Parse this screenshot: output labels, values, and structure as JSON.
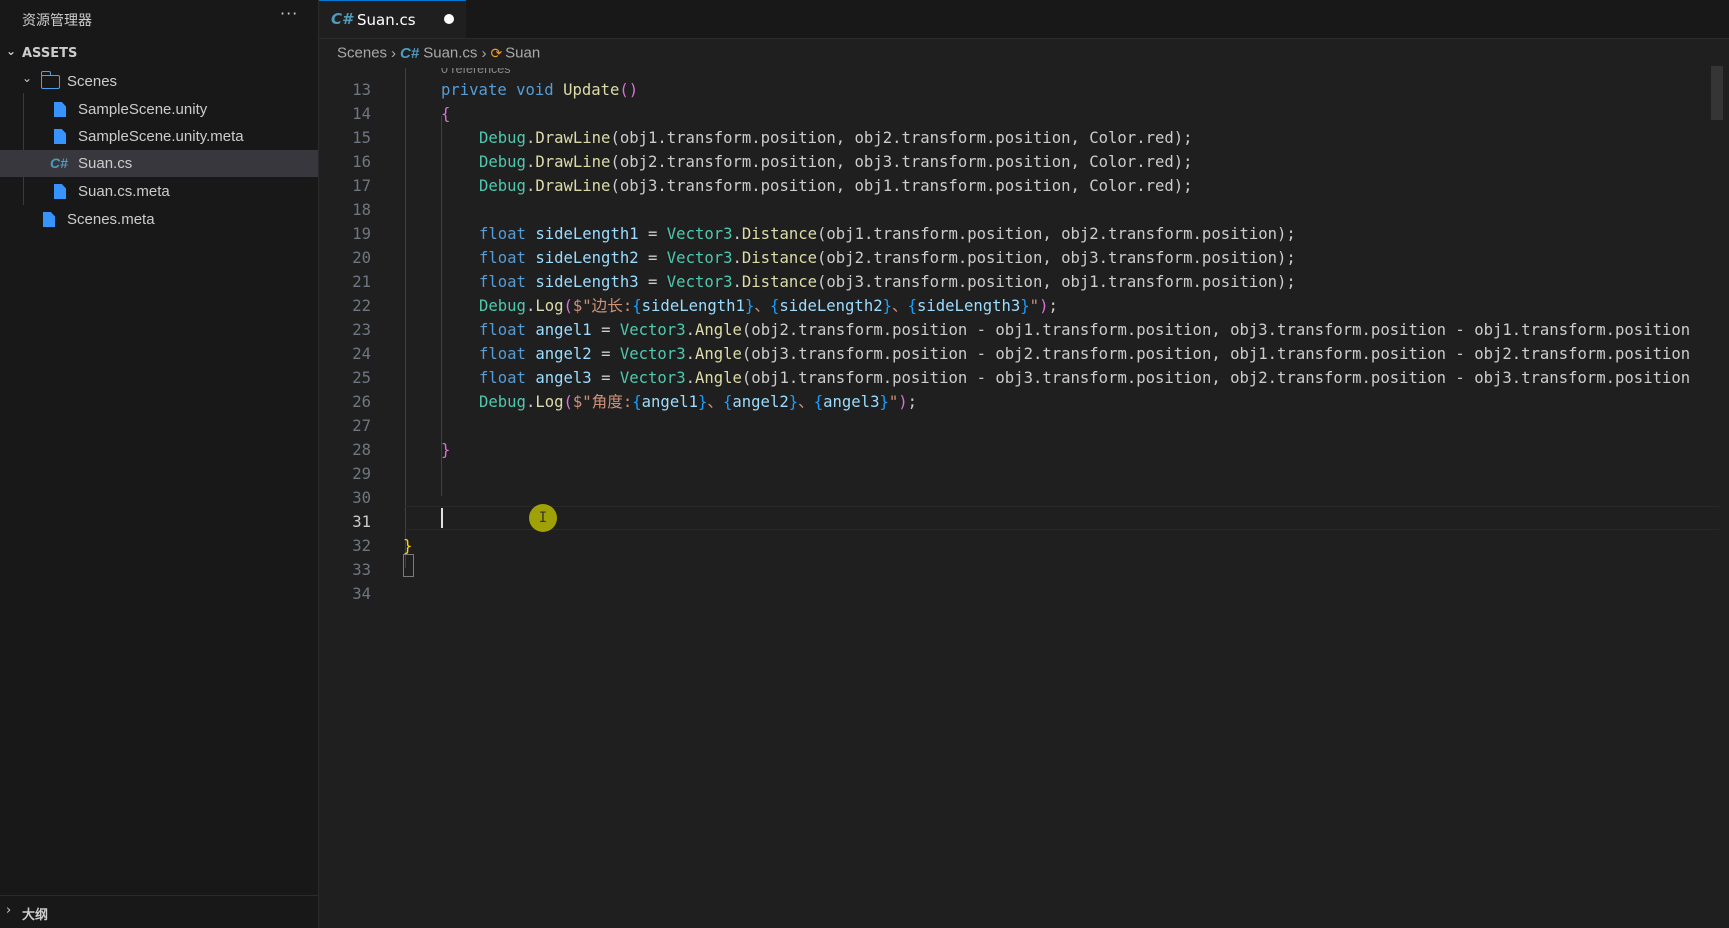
{
  "explorer": {
    "title": "资源管理器",
    "more": "···",
    "section": "ASSETS",
    "items": [
      {
        "label": "Scenes",
        "type": "folder"
      },
      {
        "label": "SampleScene.unity",
        "type": "file"
      },
      {
        "label": "SampleScene.unity.meta",
        "type": "file"
      },
      {
        "label": "Suan.cs",
        "type": "csharp",
        "selected": true
      },
      {
        "label": "Suan.cs.meta",
        "type": "file"
      },
      {
        "label": "Scenes.meta",
        "type": "file"
      }
    ],
    "outline": "大纲"
  },
  "tab": {
    "icon": "C#",
    "label": "Suan.cs",
    "dirty": true
  },
  "breadcrumb": {
    "folder": "Scenes",
    "file_icon": "C#",
    "file": "Suan.cs",
    "symbol": "Suan"
  },
  "editor": {
    "codelens": "0 references",
    "active_line": 31,
    "lines": [
      13,
      14,
      15,
      16,
      17,
      18,
      19,
      20,
      21,
      22,
      23,
      24,
      25,
      26,
      27,
      28,
      29,
      30,
      31,
      32,
      33,
      34
    ],
    "code": {
      "l13_kw": "private void ",
      "l13_fn": "Update",
      "l13_p": "()",
      "l14": "{",
      "l15_a": "Debug",
      "l15_b": ".",
      "l15_c": "DrawLine",
      "l15_d": "(obj1.transform.position, obj2.transform.position, Color.red);",
      "l16_d": "(obj2.transform.position, obj3.transform.position, Color.red);",
      "l17_d": "(obj3.transform.position, obj1.transform.position, Color.red);",
      "l19_v": "sideLength1",
      "l19_r": "(obj1.transform.position, obj2.transform.position);",
      "l20_v": "sideLength2",
      "l20_r": "(obj2.transform.position, obj3.transform.position);",
      "l21_v": "sideLength3",
      "l21_r": "(obj3.transform.position, obj1.transform.position);",
      "float": "float",
      "vec": "Vector3",
      "distance": "Distance",
      "angle": "Angle",
      "eq": " = ",
      "debug": "Debug",
      "log": "Log",
      "drawline": "DrawLine",
      "l22_s1": "$\"边长:",
      "l22_i1": "sideLength1",
      "l22_s2": "、",
      "l22_i2": "sideLength2",
      "l22_s3": "、",
      "l22_i3": "sideLength3",
      "l22_end": "\"",
      "l24_v": "angel1",
      "l24_r": "(obj2.transform.position - obj1.transform.position, obj3.transform.position - obj1.transform.position",
      "l25_v": "angel2",
      "l25_r": "(obj3.transform.position - obj2.transform.position, obj1.transform.position - obj2.transform.position",
      "l26_v": "angel3",
      "l26_r": "(obj1.transform.position - obj3.transform.position, obj2.transform.position - obj3.transform.position",
      "l27_s1": "$\"角度:",
      "l27_i1": "angel1",
      "l27_s2": "、",
      "l27_i2": "angel2",
      "l27_s3": "、",
      "l27_i3": "angel3",
      "l27_end": "\"",
      "l29": "}",
      "l33": "}"
    }
  },
  "cursor_glyph": "I"
}
